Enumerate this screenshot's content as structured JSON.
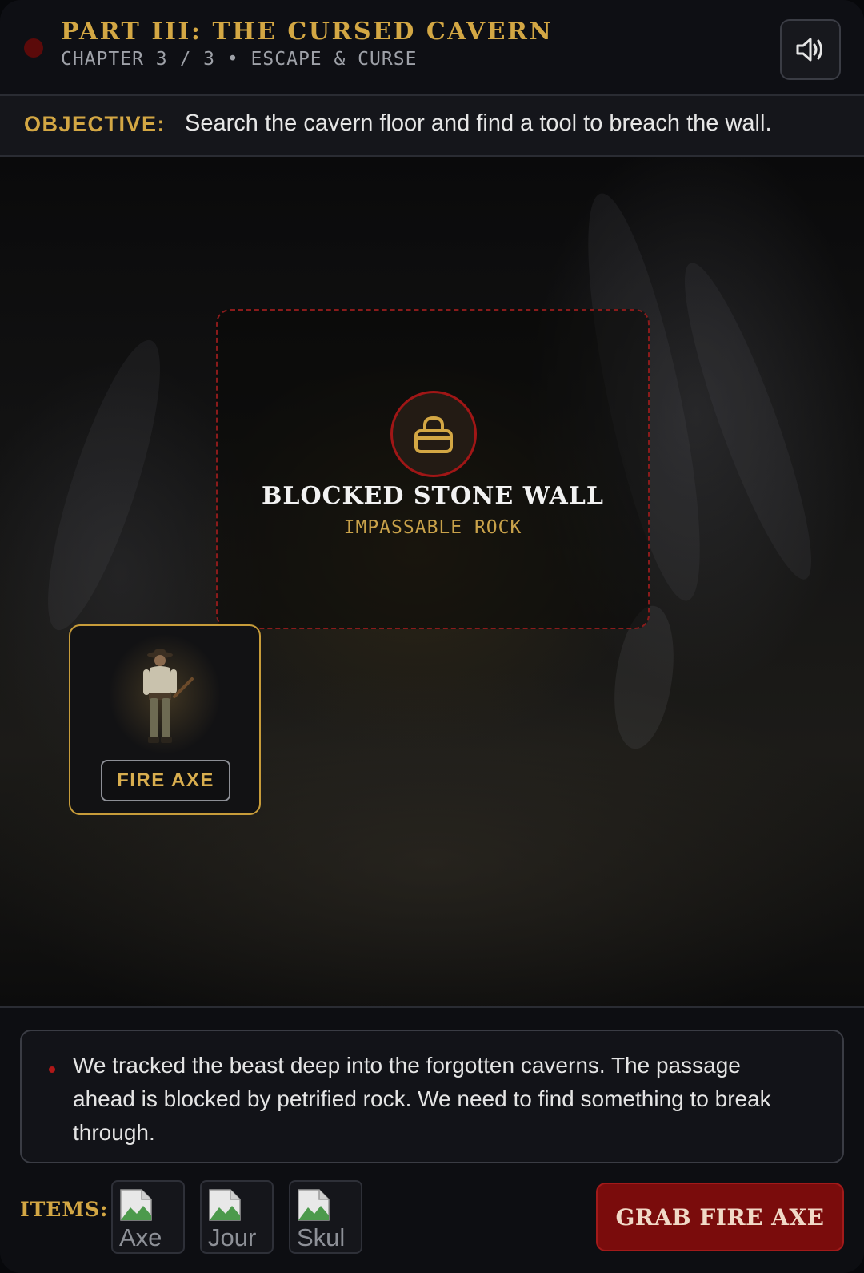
{
  "header": {
    "title": "PART III: THE CURSED CAVERN",
    "subtitle": "CHAPTER 3 / 3 • ESCAPE & CURSE",
    "sound_icon": "speaker-icon"
  },
  "objective": {
    "label": "OBJECTIVE:",
    "text": "Search the cavern floor and find a tool to breach the wall."
  },
  "scene": {
    "wall": {
      "icon": "lock-icon",
      "title": "BLOCKED STONE WALL",
      "subtitle": "IMPASSABLE ROCK"
    },
    "item_card": {
      "label": "FIRE AXE",
      "image": "explorer-character-figure"
    }
  },
  "dialogue": {
    "text": "We tracked the beast deep into the forgotten caverns. The passage ahead is blocked by petrified rock. We need to find something to break through."
  },
  "inventory": {
    "label": "ITEMS:",
    "slots": [
      {
        "alt": "Axe"
      },
      {
        "alt": "Jour"
      },
      {
        "alt": "Skul"
      }
    ]
  },
  "action": {
    "label": "GRAB FIRE AXE"
  },
  "colors": {
    "accent_gold": "#d3a744",
    "danger_red": "#8a1b1b",
    "button_red": "#7a0c0c",
    "background": "#0b0c10"
  }
}
